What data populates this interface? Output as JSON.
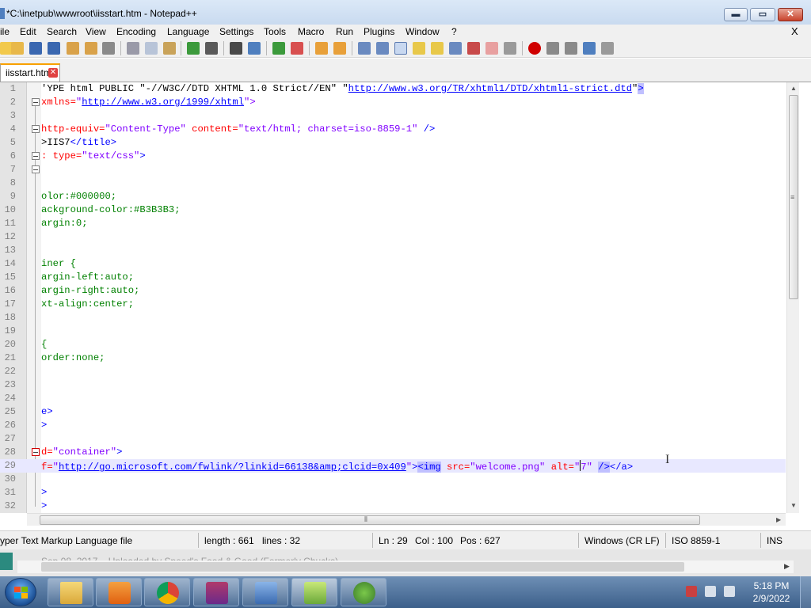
{
  "window": {
    "title": "*C:\\inetpub\\wwwroot\\iisstart.htm - Notepad++",
    "min_glyph": "▬",
    "max_glyph": "▭",
    "close_glyph": "✕"
  },
  "menu": {
    "items": [
      "ile",
      "Edit",
      "Search",
      "View",
      "Encoding",
      "Language",
      "Settings",
      "Tools",
      "Macro",
      "Run",
      "Plugins",
      "Window",
      "?"
    ],
    "close_label": "X"
  },
  "toolbar": {
    "icons": [
      "open-icon",
      "save-icon",
      "save-all-icon",
      "close-file-icon",
      "close-all-icon",
      "print-icon",
      "cut-icon",
      "copy-icon",
      "paste-icon",
      "undo-icon",
      "redo-icon",
      "find-icon",
      "replace-icon",
      "zoom-in-icon",
      "zoom-out-icon",
      "sync-vertical-icon",
      "sync-horizontal-icon",
      "word-wrap-icon",
      "show-all-chars-icon",
      "indent-guide-icon",
      "udl-icon",
      "doc-map-icon",
      "function-list-icon",
      "folder-workspace-icon",
      "monitoring-icon",
      "record-macro-icon",
      "stop-macro-icon",
      "play-macro-icon",
      "run-multiple-icon",
      "save-macro-icon"
    ]
  },
  "tab": {
    "label": "iisstart.htm",
    "close_glyph": "✕"
  },
  "editor": {
    "lines": [
      {
        "n": "1",
        "segs": [
          {
            "t": "'YPE html PUBLIC ",
            "c": "#000000"
          },
          {
            "t": "\"-//W3C//DTD XHTML 1.0 Strict//EN\"",
            "c": "#000000"
          },
          {
            "t": " ",
            "c": "#000000"
          },
          {
            "t": "\"",
            "c": "#000000"
          },
          {
            "t": "http://www.w3.org/TR/xhtml1/DTD/xhtml1-strict.dtd",
            "c": "#0000ff",
            "u": true
          },
          {
            "t": "\"",
            "c": "#000000"
          },
          {
            "t": ">",
            "c": "#0000ff",
            "sel": true
          }
        ]
      },
      {
        "n": "2",
        "segs": [
          {
            "t": "xmlns=",
            "c": "#ff0000"
          },
          {
            "t": "\"",
            "c": "#8000ff"
          },
          {
            "t": "http://www.w3.org/1999/xhtml",
            "c": "#0000ff",
            "u": true
          },
          {
            "t": "\">",
            "c": "#8000ff"
          }
        ]
      },
      {
        "n": "3",
        "segs": []
      },
      {
        "n": "4",
        "segs": [
          {
            "t": "http-equiv=",
            "c": "#ff0000"
          },
          {
            "t": "\"Content-Type\"",
            "c": "#8000ff"
          },
          {
            "t": " content=",
            "c": "#ff0000"
          },
          {
            "t": "\"text/html; charset=iso-8859-1\"",
            "c": "#8000ff"
          },
          {
            "t": " />",
            "c": "#0000ff"
          }
        ]
      },
      {
        "n": "5",
        "segs": [
          {
            "t": ">IIS7",
            "c": "#000000"
          },
          {
            "t": "</title>",
            "c": "#0000ff"
          }
        ]
      },
      {
        "n": "6",
        "segs": [
          {
            "t": ": type=",
            "c": "#ff0000"
          },
          {
            "t": "\"text/css\"",
            "c": "#8000ff"
          },
          {
            "t": ">",
            "c": "#0000ff"
          }
        ]
      },
      {
        "n": "7",
        "segs": []
      },
      {
        "n": "8",
        "segs": []
      },
      {
        "n": "9",
        "segs": [
          {
            "t": "olor:#000000;",
            "c": "#008000"
          }
        ]
      },
      {
        "n": "10",
        "segs": [
          {
            "t": "ackground-color:#B3B3B3;",
            "c": "#008000"
          }
        ]
      },
      {
        "n": "11",
        "segs": [
          {
            "t": "argin:0;",
            "c": "#008000"
          }
        ]
      },
      {
        "n": "12",
        "segs": []
      },
      {
        "n": "13",
        "segs": []
      },
      {
        "n": "14",
        "segs": [
          {
            "t": "iner {",
            "c": "#008000"
          }
        ]
      },
      {
        "n": "15",
        "segs": [
          {
            "t": "argin-left:auto;",
            "c": "#008000"
          }
        ]
      },
      {
        "n": "16",
        "segs": [
          {
            "t": "argin-right:auto;",
            "c": "#008000"
          }
        ]
      },
      {
        "n": "17",
        "segs": [
          {
            "t": "xt-align:center;",
            "c": "#008000"
          }
        ]
      },
      {
        "n": "18",
        "segs": []
      },
      {
        "n": "19",
        "segs": []
      },
      {
        "n": "20",
        "segs": [
          {
            "t": "{",
            "c": "#008000"
          }
        ]
      },
      {
        "n": "21",
        "segs": [
          {
            "t": "order:none;",
            "c": "#008000"
          }
        ]
      },
      {
        "n": "22",
        "segs": []
      },
      {
        "n": "23",
        "segs": []
      },
      {
        "n": "24",
        "segs": []
      },
      {
        "n": "25",
        "segs": [
          {
            "t": "e>",
            "c": "#0000ff"
          }
        ]
      },
      {
        "n": "26",
        "segs": [
          {
            "t": ">",
            "c": "#0000ff"
          }
        ]
      },
      {
        "n": "27",
        "segs": []
      },
      {
        "n": "28",
        "segs": [
          {
            "t": "d=",
            "c": "#ff0000"
          },
          {
            "t": "\"container\"",
            "c": "#8000ff"
          },
          {
            "t": ">",
            "c": "#0000ff"
          }
        ]
      },
      {
        "n": "29",
        "segs": [
          {
            "t": "f=",
            "c": "#ff0000"
          },
          {
            "t": "\"",
            "c": "#8000ff"
          },
          {
            "t": "http://go.microsoft.com/fwlink/?linkid=66138&amp;clcid=0x409",
            "c": "#0000ff",
            "u": true
          },
          {
            "t": "\"",
            "c": "#8000ff"
          },
          {
            "t": ">",
            "c": "#0000ff"
          },
          {
            "t": "<img",
            "c": "#0000ff",
            "sel": true
          },
          {
            "t": " src=",
            "c": "#ff0000"
          },
          {
            "t": "\"welcome.png\"",
            "c": "#8000ff"
          },
          {
            "t": " alt=",
            "c": "#ff0000"
          },
          {
            "t": "\"",
            "c": "#8000ff"
          },
          {
            "t": "|",
            "caret": true
          },
          {
            "t": "7\"",
            "c": "#8000ff"
          },
          {
            "t": " ",
            "c": "#000000"
          },
          {
            "t": "/>",
            "c": "#0000ff",
            "sel": true
          },
          {
            "t": "</a>",
            "c": "#0000ff"
          }
        ]
      },
      {
        "n": "30",
        "segs": []
      },
      {
        "n": "31",
        "segs": [
          {
            "t": ">",
            "c": "#0000ff"
          }
        ]
      },
      {
        "n": "32",
        "segs": [
          {
            "t": ">",
            "c": "#0000ff"
          }
        ]
      }
    ],
    "fold_open_lines": [
      "2",
      "4",
      "6",
      "7",
      "28"
    ],
    "fold_red_lines": [
      "28"
    ],
    "current_line": "29"
  },
  "status": {
    "filetype": "yper Text Markup Language file",
    "length": "length : 661",
    "lines": "lines : 32",
    "ln": "Ln : 29",
    "col": "Col : 100",
    "pos": "Pos : 627",
    "eol": "Windows (CR LF)",
    "encoding": "ISO 8859-1",
    "mode": "INS"
  },
  "background_window": {
    "text": "Sep 08, 2017 – Uploaded by Speed's Food & Good (Formerly Chucks)"
  },
  "taskbar": {
    "time": "5:18 PM",
    "date": "2/9/2022",
    "apps": [
      "explorer-icon",
      "media-player-icon",
      "chrome-icon",
      "winrar-icon",
      "windows-update-icon",
      "notepad-plus-plus-icon",
      "gecko-icon"
    ]
  }
}
